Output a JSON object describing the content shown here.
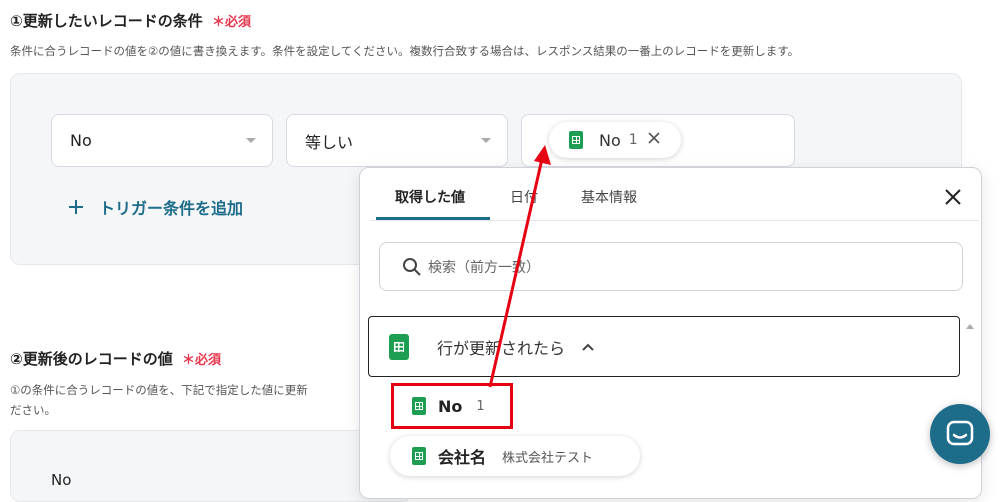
{
  "section1": {
    "title": "①更新したいレコードの条件",
    "required_mark": "＊",
    "required_label": "必須",
    "description": "条件に合うレコードの値を②の値に書き換えます。条件を設定してください。複数行合致する場合は、レスポンス結果の一番上のレコードを更新します。",
    "field_select": "No",
    "operator_select": "等しい",
    "value_chip": {
      "label": "No",
      "value": "1"
    },
    "add_condition_label": "トリガー条件を追加"
  },
  "section2": {
    "title": "②更新後のレコードの値",
    "required_mark": "＊",
    "required_label": "必須",
    "description_line1": "①の条件に合うレコードの値を、下記で指定した値に更新",
    "description_line2": "ださい。",
    "first_field_label": "No"
  },
  "dropdown": {
    "tabs": [
      {
        "label": "取得した値",
        "active": true
      },
      {
        "label": "日付",
        "active": false
      },
      {
        "label": "基本情報",
        "active": false
      }
    ],
    "search_placeholder": "検索（前方一致）",
    "group_label": "行が更新されたら",
    "items": [
      {
        "label": "No",
        "value": "1"
      },
      {
        "label": "会社名",
        "value": "株式会社テスト"
      }
    ]
  },
  "colors": {
    "required": "#e8384f",
    "accent": "#1d6d8a",
    "sheets_green": "#1e9e52",
    "annotation_red": "#e60012"
  },
  "icons": [
    "chevron-down-icon",
    "close-icon",
    "plus-icon",
    "search-icon",
    "chevron-up-icon",
    "sheets-icon",
    "chat-icon"
  ]
}
